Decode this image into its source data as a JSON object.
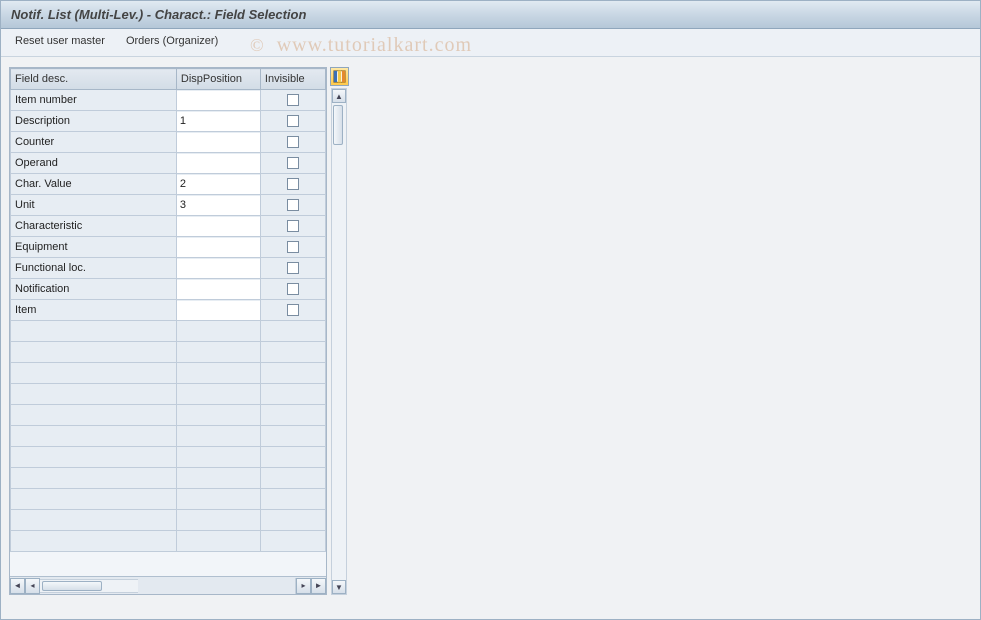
{
  "title": "Notif. List (Multi-Lev.) - Charact.: Field Selection",
  "toolbar": {
    "reset_label": "Reset user master",
    "organizer_label": "Orders (Organizer)"
  },
  "table": {
    "headers": {
      "field_desc": "Field desc.",
      "disp_position": "DispPosition",
      "invisible": "Invisible"
    },
    "rows": [
      {
        "desc": "Item number",
        "pos": "",
        "inv": false
      },
      {
        "desc": "Description",
        "pos": "1",
        "inv": false
      },
      {
        "desc": "Counter",
        "pos": "",
        "inv": false
      },
      {
        "desc": "Operand",
        "pos": "",
        "inv": false
      },
      {
        "desc": "Char. Value",
        "pos": "2",
        "inv": false
      },
      {
        "desc": "Unit",
        "pos": "3",
        "inv": false
      },
      {
        "desc": "Characteristic",
        "pos": "",
        "inv": false
      },
      {
        "desc": "Equipment",
        "pos": "",
        "inv": false
      },
      {
        "desc": "Functional loc.",
        "pos": "",
        "inv": false
      },
      {
        "desc": "Notification",
        "pos": "",
        "inv": false
      },
      {
        "desc": "Item",
        "pos": "",
        "inv": false
      }
    ],
    "empty_row_count": 11
  },
  "watermark": "www.tutorialkart.com",
  "watermark_copy": "©"
}
